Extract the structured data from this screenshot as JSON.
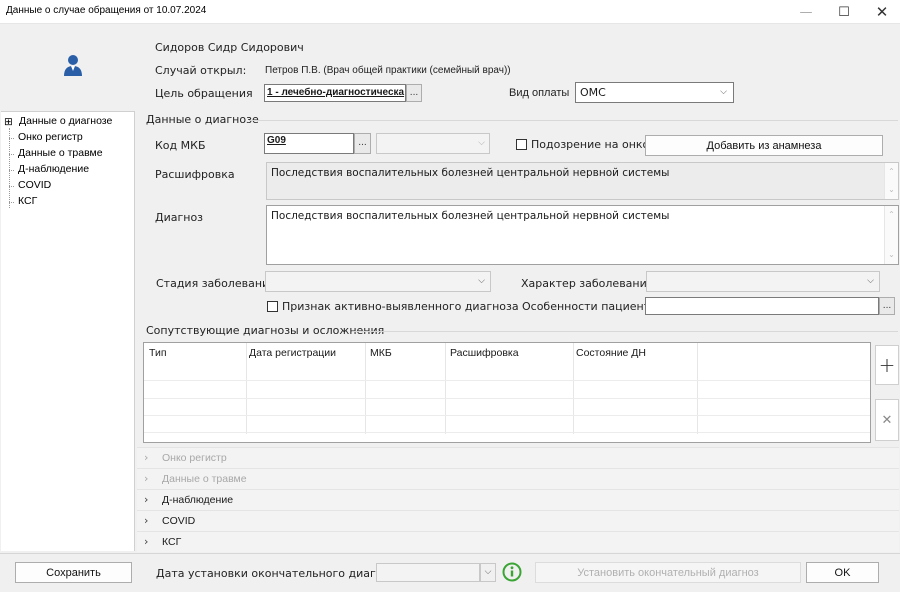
{
  "window": {
    "title": "Данные о случае обращения от 10.07.2024",
    "minimize": "—",
    "maximize": "☐",
    "close": "✕"
  },
  "header": {
    "patient_name": "Сидоров Сидр Сидорович",
    "opened_label": "Случай открыл:",
    "opened_value": "Петров П.В. (Врач общей практики (семейный врач))",
    "purpose_label": "Цель обращения",
    "purpose_value": "1 - лечебно-диагностическа",
    "payment_label": "Вид оплаты",
    "payment_value": "ОМС",
    "avatar_icon": "user-icon"
  },
  "sidebar": {
    "items": [
      {
        "label": "Данные о диагнозе"
      },
      {
        "label": "Онко регистр"
      },
      {
        "label": "Данные о травме"
      },
      {
        "label": "Д-наблюдение"
      },
      {
        "label": "COVID"
      },
      {
        "label": "КСГ"
      }
    ],
    "expander": "⊞"
  },
  "diagnosis": {
    "group_title": "Данные о диагнозе",
    "mkb_label": "Код МКБ",
    "mkb_value": "G09",
    "onco_suspicion_label": "Подозрение на онко",
    "add_from_anamnesis_label": "Добавить из анамнеза",
    "decoding_label": "Расшифровка",
    "decoding_value": "Последствия воспалительных болезней центральной нервной системы",
    "diagnosis_label": "Диагноз",
    "diagnosis_value": "Последствия воспалительных болезней центральной нервной системы",
    "stage_label": "Стадия заболевания",
    "character_label": "Характер заболевания",
    "active_detection_label": "Признак активно-выявленного диагноза",
    "patient_features_label": "Особенности пациента",
    "dots": "..."
  },
  "concomitant": {
    "group_title": "Сопутствующие диагнозы и осложнения",
    "columns": [
      "Тип",
      "Дата регистрации",
      "МКБ",
      "Расшифровка",
      "Состояние ДН"
    ],
    "add_icon": "+",
    "remove_icon": "✕"
  },
  "sections": [
    {
      "label": "Онко регистр",
      "enabled": false
    },
    {
      "label": "Данные о травме",
      "enabled": false
    },
    {
      "label": "Д-наблюдение",
      "enabled": true
    },
    {
      "label": "COVID",
      "enabled": true
    },
    {
      "label": "КСГ",
      "enabled": true
    }
  ],
  "footer": {
    "save_label": "Сохранить",
    "final_date_label": "Дата установки окончательного диагноза:",
    "set_final_label": "Установить окончательный диагноз",
    "ok_label": "OK",
    "info_icon": "info-icon"
  },
  "colors": {
    "avatar": "#2a5fa8",
    "info": "#3aa535"
  }
}
